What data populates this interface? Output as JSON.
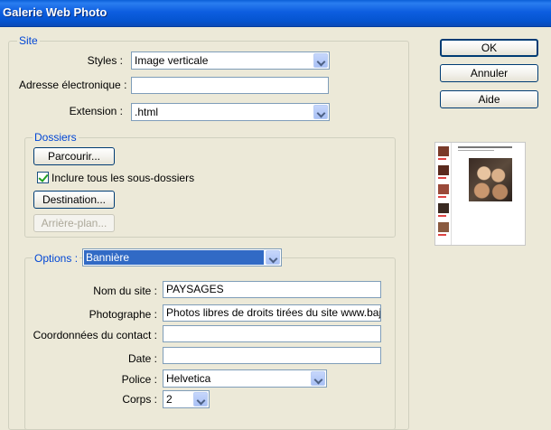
{
  "window": {
    "title": "Galerie Web Photo"
  },
  "buttons": {
    "ok": "OK",
    "cancel": "Annuler",
    "help": "Aide"
  },
  "site": {
    "legend": "Site",
    "styles_label": "Styles :",
    "styles_value": "Image verticale",
    "email_label": "Adresse électronique :",
    "email_value": "",
    "extension_label": "Extension :",
    "extension_value": ".html"
  },
  "dossiers": {
    "legend": "Dossiers",
    "browse": "Parcourir...",
    "include_subfolders": "Inclure tous les sous-dossiers",
    "include_subfolders_checked": true,
    "destination": "Destination...",
    "background": "Arrière-plan..."
  },
  "options": {
    "legend": "Options :",
    "section_value": "Bannière",
    "site_name_label": "Nom du site :",
    "site_name_value": "PAYSAGES",
    "photographer_label": "Photographe :",
    "photographer_value": "Photos libres de droits tirées du site www.baj",
    "contact_label": "Coordonnées du contact :",
    "contact_value": "",
    "date_label": "Date :",
    "date_value": "",
    "font_label": "Police :",
    "font_value": "Helvetica",
    "size_label": "Corps :",
    "size_value": "2"
  },
  "colors": {
    "titlebar": "#0554d0",
    "legend_text": "#0046d5",
    "selection": "#316ac5",
    "dialog_bg": "#ece9d8"
  }
}
